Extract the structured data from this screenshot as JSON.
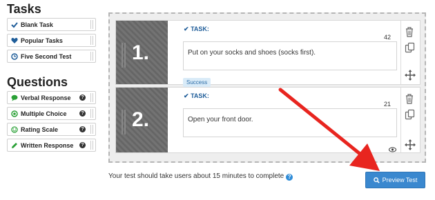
{
  "sidebar": {
    "tasks_title": "Tasks",
    "tasks": [
      {
        "label": "Blank Task",
        "icon": "check-icon"
      },
      {
        "label": "Popular Tasks",
        "icon": "heart-icon"
      },
      {
        "label": "Five Second Test",
        "icon": "clock-icon"
      }
    ],
    "questions_title": "Questions",
    "questions": [
      {
        "label": "Verbal Response",
        "icon": "speech-bubble-icon"
      },
      {
        "label": "Multiple Choice",
        "icon": "radio-icon"
      },
      {
        "label": "Rating Scale",
        "icon": "smiley-icon"
      },
      {
        "label": "Written Response",
        "icon": "pencil-icon"
      }
    ]
  },
  "tasks": [
    {
      "number": "1.",
      "label": "TASK:",
      "count": "42",
      "text": "Put on your socks and shoes (socks first).",
      "badge": "Success"
    },
    {
      "number": "2.",
      "label": "TASK:",
      "count": "21",
      "text": "Open your front door."
    }
  ],
  "footer": {
    "message": "Your test should take users about 15 minutes to complete",
    "preview_label": "Preview Test"
  },
  "colors": {
    "accent": "#3a88cf",
    "task_label": "#1f5d99",
    "arrow": "#e8251f"
  }
}
